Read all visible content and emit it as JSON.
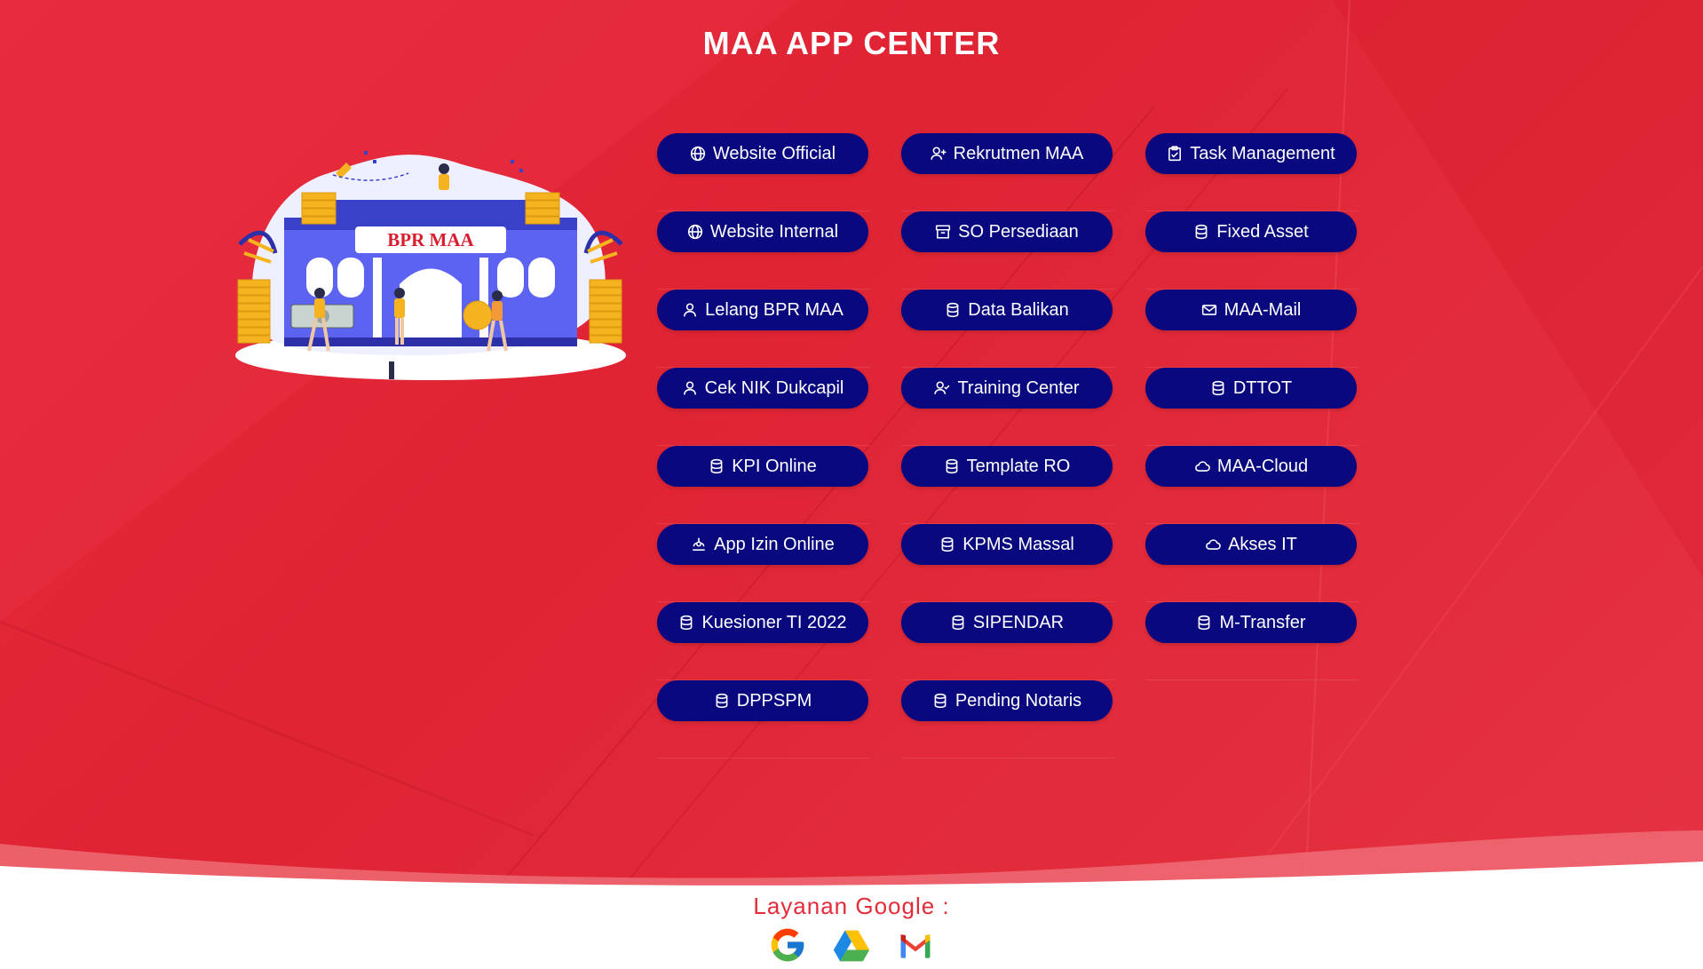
{
  "page": {
    "title": "MAA APP CENTER"
  },
  "illustration": {
    "sign_text": "BPR MAA"
  },
  "apps": [
    {
      "label": "Website Official",
      "icon": "globe-icon"
    },
    {
      "label": "Rekrutmen MAA",
      "icon": "user-plus-icon"
    },
    {
      "label": "Task Management",
      "icon": "clipboard-check-icon"
    },
    {
      "label": "Website Internal",
      "icon": "globe-icon"
    },
    {
      "label": "SO Persediaan",
      "icon": "archive-icon"
    },
    {
      "label": "Fixed Asset",
      "icon": "database-icon"
    },
    {
      "label": "Lelang BPR MAA",
      "icon": "user-icon"
    },
    {
      "label": "Data Balikan",
      "icon": "database-icon"
    },
    {
      "label": "MAA-Mail",
      "icon": "mail-icon"
    },
    {
      "label": "Cek NIK Dukcapil",
      "icon": "user-icon"
    },
    {
      "label": "Training Center",
      "icon": "user-check-icon"
    },
    {
      "label": "DTTOT",
      "icon": "database-icon"
    },
    {
      "label": "KPI Online",
      "icon": "database-icon"
    },
    {
      "label": "Template RO",
      "icon": "database-icon"
    },
    {
      "label": "MAA-Cloud",
      "icon": "cloud-icon"
    },
    {
      "label": "App Izin Online",
      "icon": "fingerprint-icon"
    },
    {
      "label": "KPMS Massal",
      "icon": "database-icon"
    },
    {
      "label": "Akses IT",
      "icon": "cloud-icon"
    },
    {
      "label": "Kuesioner TI 2022",
      "icon": "database-icon"
    },
    {
      "label": "SIPENDAR",
      "icon": "database-icon"
    },
    {
      "label": "M-Transfer",
      "icon": "database-icon"
    },
    {
      "label": "DPPSPM",
      "icon": "database-icon"
    },
    {
      "label": "Pending Notaris",
      "icon": "database-icon"
    }
  ],
  "footer": {
    "label": "Layanan Google :",
    "services": [
      {
        "icon": "google-icon"
      },
      {
        "icon": "google-drive-icon"
      },
      {
        "icon": "gmail-icon"
      }
    ]
  },
  "colors": {
    "background": "#e5283a",
    "button": "#09087e",
    "button_text": "#ffffff",
    "footer_text": "#e52b3a"
  }
}
